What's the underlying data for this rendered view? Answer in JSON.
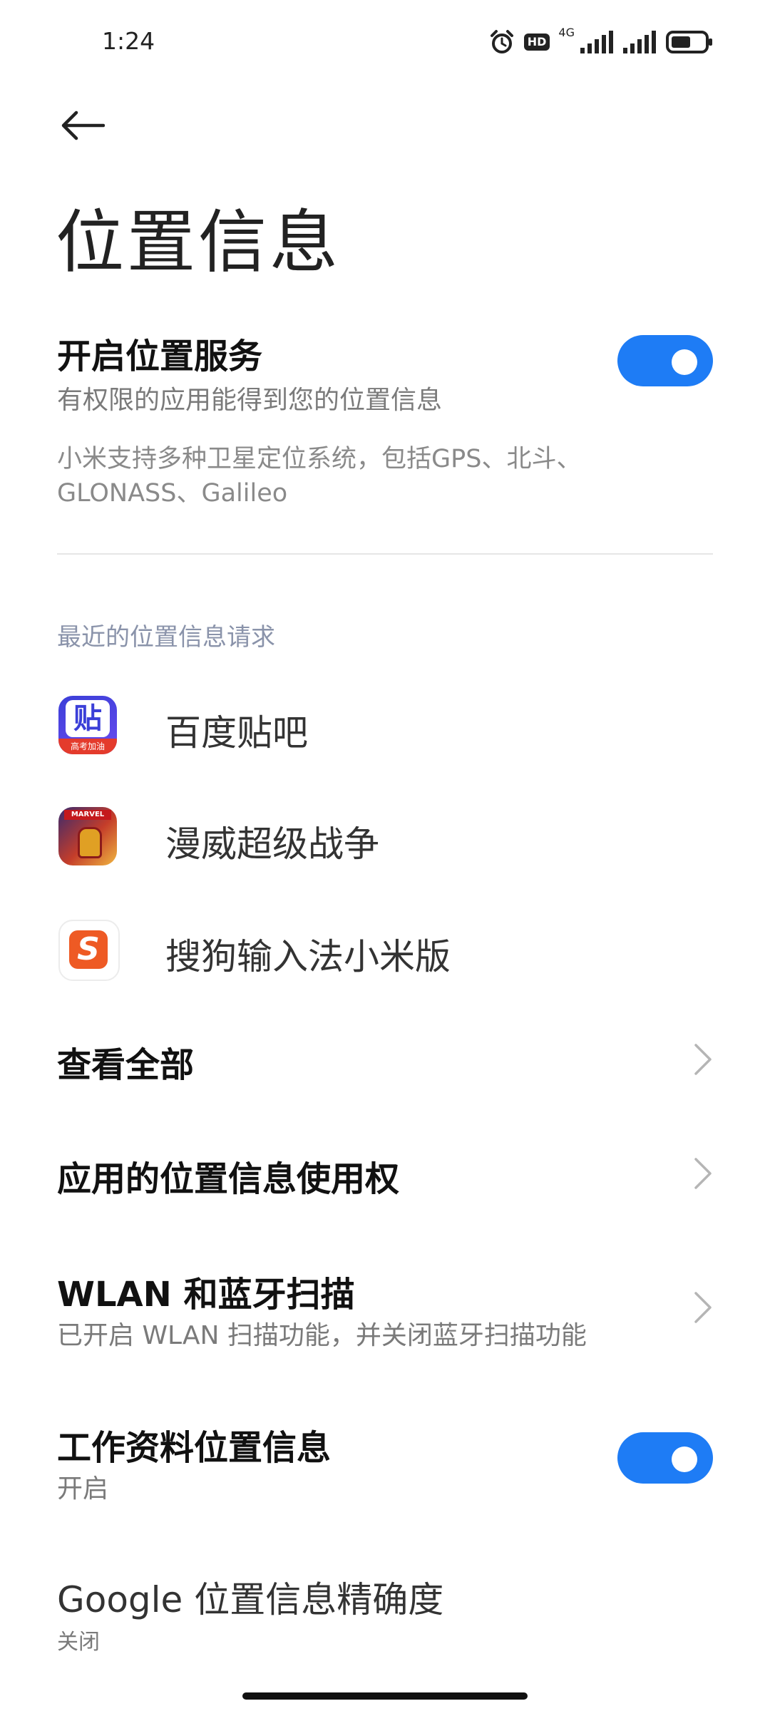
{
  "status_bar": {
    "time": "1:24",
    "network": "4G"
  },
  "header": {
    "title": "位置信息"
  },
  "location_service": {
    "title": "开启位置服务",
    "subtitle": "有权限的应用能得到您的位置信息",
    "enabled": true,
    "description": "小米支持多种卫星定位系统，包括GPS、北斗、GLONASS、Galileo"
  },
  "recent_requests": {
    "label": "最近的位置信息请求",
    "apps": [
      {
        "name": "百度贴吧",
        "icon": "baidu-tieba-icon",
        "icon_text": "贴",
        "icon_caption": "高考加油"
      },
      {
        "name": "漫威超级战争",
        "icon": "marvel-super-war-icon",
        "icon_text": "MARVEL"
      },
      {
        "name": "搜狗输入法小米版",
        "icon": "sogou-input-icon",
        "icon_text": "S"
      }
    ]
  },
  "settings": {
    "view_all": "查看全部",
    "app_permission": "应用的位置信息使用权",
    "wlan_bt": {
      "title": "WLAN 和蓝牙扫描",
      "subtitle": "已开启 WLAN 扫描功能，并关闭蓝牙扫描功能"
    },
    "work_profile": {
      "title": "工作资料位置信息",
      "subtitle": "开启",
      "enabled": true
    },
    "google_accuracy": {
      "title": "Google 位置信息精确度",
      "subtitle": "关闭"
    }
  },
  "colors": {
    "accent": "#1e7cf5",
    "section_label": "#8a93aa"
  }
}
